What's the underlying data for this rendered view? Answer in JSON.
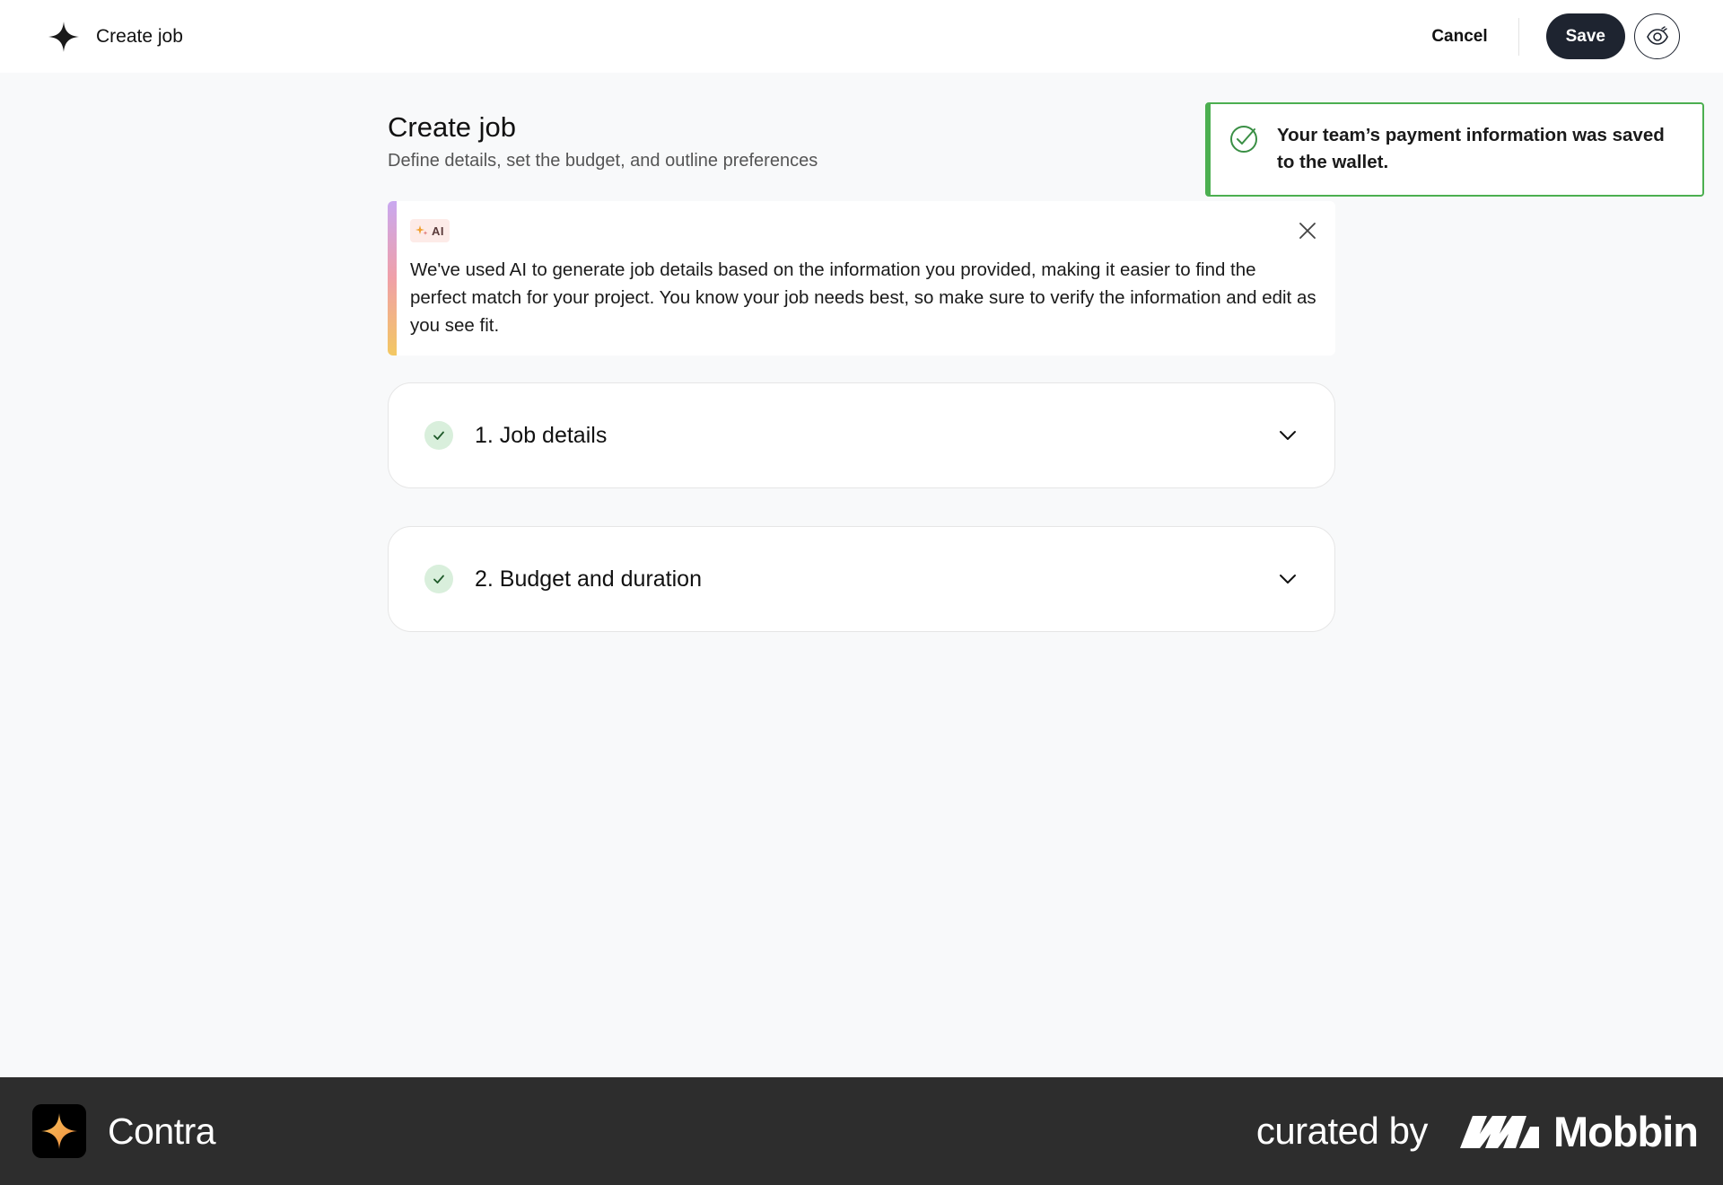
{
  "header": {
    "app_title": "Create job",
    "cancel_label": "Cancel",
    "save_label": "Save"
  },
  "page": {
    "title": "Create job",
    "subtitle": "Define details, set the budget, and outline preferences"
  },
  "ai_notice": {
    "badge": "AI",
    "text": "We've used AI to generate job details based on the information you provided, making it easier to find the perfect match for your project. You know your job needs best, so make sure to verify the information and edit as you see fit."
  },
  "sections": [
    {
      "label": "1. Job details",
      "status": "complete"
    },
    {
      "label": "2. Budget and duration",
      "status": "complete"
    }
  ],
  "toast": {
    "message": "Your team’s payment information was saved to the wallet."
  },
  "footer": {
    "brand": "Contra",
    "curated_by": "curated by",
    "curator": "Mobbin"
  },
  "colors": {
    "primary_button": "#1e2430",
    "success": "#4caf50",
    "check_bg": "#d9efdc",
    "page_bg": "#f8f9fa",
    "footer_bg": "#2d2d2d"
  }
}
